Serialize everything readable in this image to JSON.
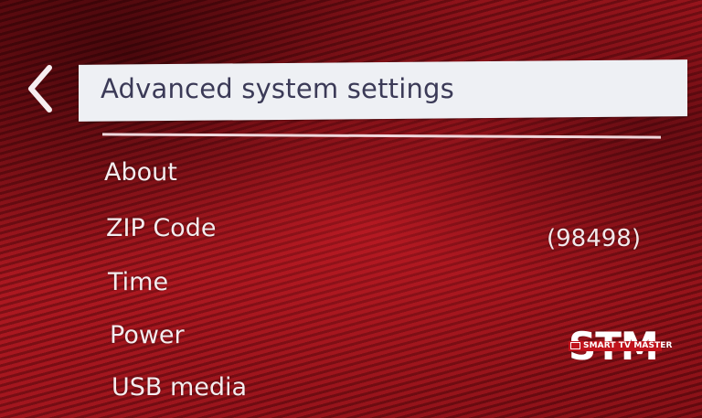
{
  "header": {
    "title": "Advanced system settings",
    "back_icon": "chevron-left-icon"
  },
  "menu": {
    "items": [
      {
        "label": "About"
      },
      {
        "label": "ZIP Code",
        "value": "(98498)"
      },
      {
        "label": "Time"
      },
      {
        "label": "Power"
      },
      {
        "label": "USB media"
      }
    ]
  },
  "watermark": {
    "logo_text": "STM",
    "tagline": "SMART TV MASTER"
  },
  "colors": {
    "background": "#8a0d14",
    "title_bar": "#eef0f4",
    "title_text": "#3b3a57",
    "menu_text": "#f4ecee"
  }
}
